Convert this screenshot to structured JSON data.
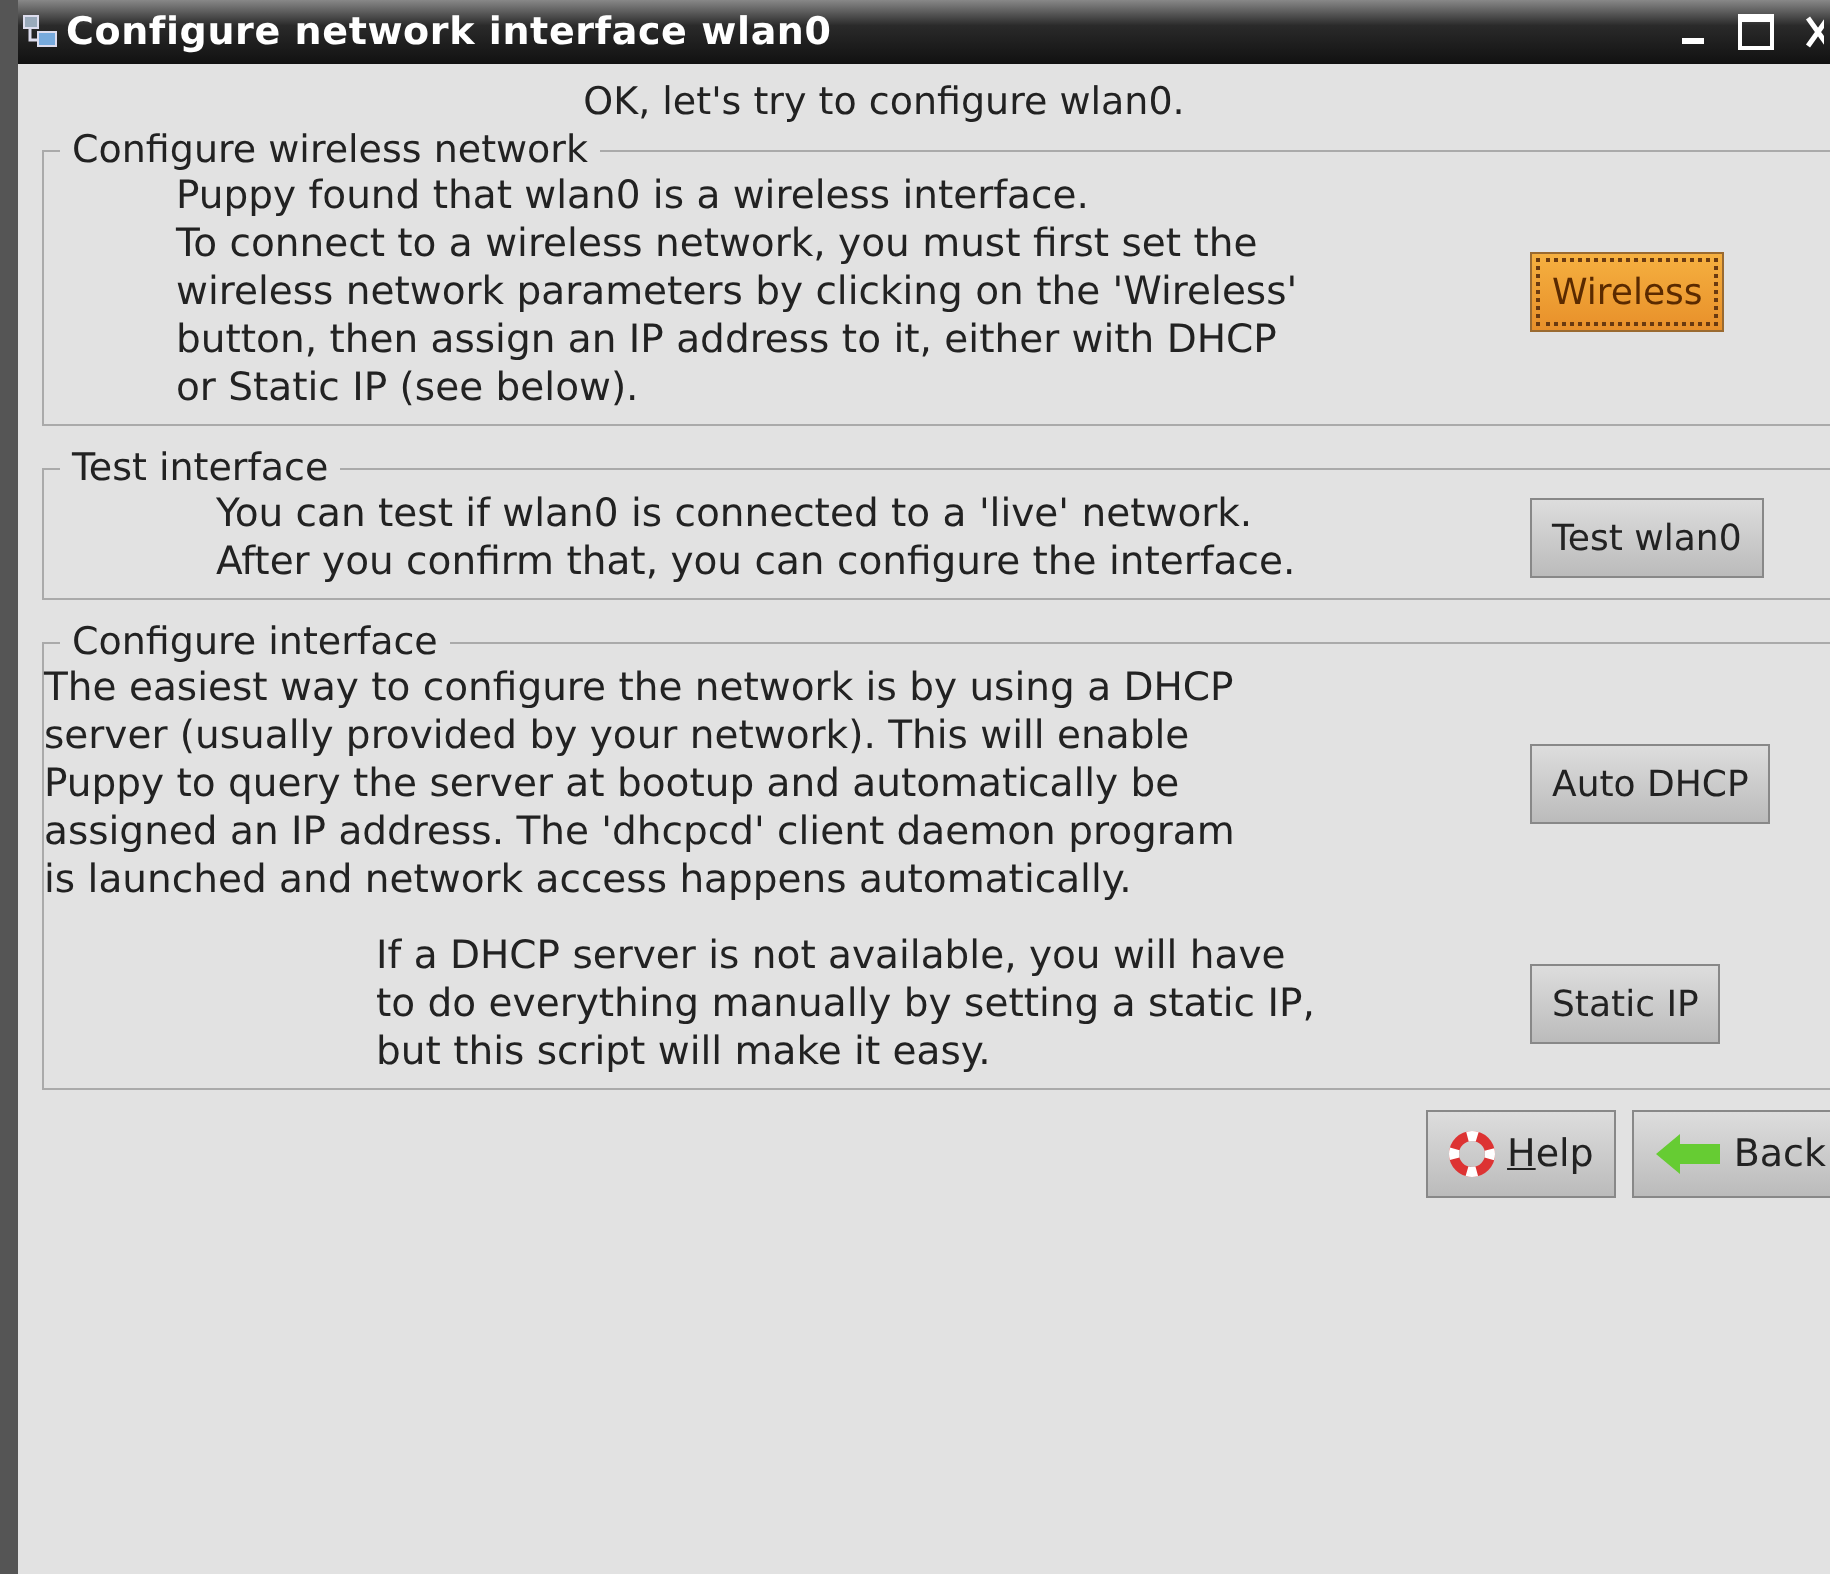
{
  "window": {
    "title": "Configure network interface wlan0"
  },
  "intro": "OK, let's try to configure wlan0.",
  "sections": [
    {
      "title": "Configure wireless network",
      "blocks": [
        {
          "text": "Puppy found that wlan0 is a wireless interface.\nTo connect to a wireless network, you must first set the\nwireless network parameters by clicking on the 'Wireless'\nbutton, then assign an IP address to it, either with DHCP\nor Static IP (see below).",
          "button": {
            "label": "Wireless",
            "focused": true
          }
        }
      ]
    },
    {
      "title": "Test interface",
      "blocks": [
        {
          "text": "You can test if wlan0 is connected to a 'live' network.\nAfter you confirm that, you can configure the interface.",
          "button": {
            "label": "Test wlan0",
            "focused": false
          }
        }
      ]
    },
    {
      "title": "Configure interface",
      "blocks": [
        {
          "text": "The easiest way to configure the network is by using a DHCP\nserver (usually provided by your network). This will enable\nPuppy to query the server at bootup and automatically be\nassigned an IP address. The 'dhcpcd' client daemon program\nis launched and network access happens automatically.",
          "button": {
            "label": "Auto DHCP",
            "focused": false
          }
        },
        {
          "text": "If a DHCP server is not available, you will have\nto do everything manually by setting a static IP,\nbut this script will make it easy.",
          "button": {
            "label": "Static IP",
            "focused": false
          }
        }
      ]
    }
  ],
  "footer_buttons": [
    {
      "kind": "help",
      "label": "Help",
      "mnemonic": true
    },
    {
      "kind": "back",
      "label": "Back",
      "mnemonic": false
    }
  ]
}
